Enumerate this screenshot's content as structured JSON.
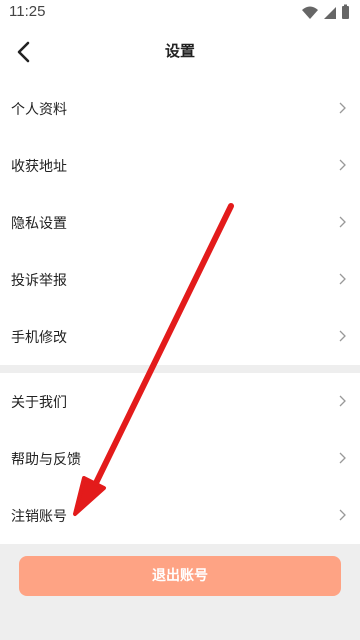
{
  "status_bar": {
    "time": "11:25",
    "icons": [
      "wifi-icon",
      "signal-icon",
      "battery-icon"
    ]
  },
  "header": {
    "title": "设置",
    "back_icon": "back-arrow-icon"
  },
  "settings": {
    "group_1": [
      {
        "label": "个人资料"
      },
      {
        "label": "收获地址"
      },
      {
        "label": "隐私设置"
      },
      {
        "label": "投诉举报"
      },
      {
        "label": "手机修改"
      }
    ],
    "group_2": [
      {
        "label": "关于我们"
      },
      {
        "label": "帮助与反馈"
      },
      {
        "label": "注销账号"
      }
    ]
  },
  "footer": {
    "logout_label": "退出账号"
  },
  "colors": {
    "logout_button": "#fea384",
    "annotation_arrow": "#e31b1b",
    "section_background": "#eeeeee"
  }
}
